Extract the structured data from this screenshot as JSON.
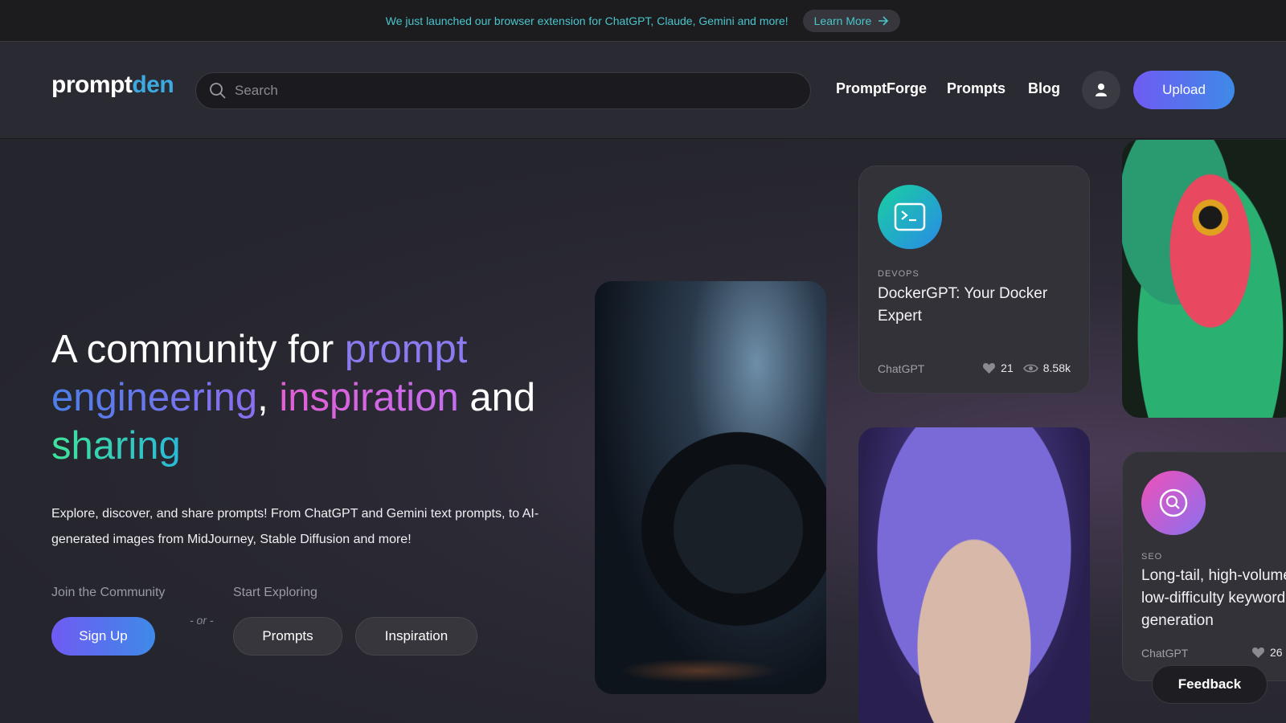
{
  "announcement": {
    "text": "We just launched our browser extension for ChatGPT, Claude, Gemini and more!",
    "button": "Learn More",
    "icon": "arrow-right-icon"
  },
  "header": {
    "logo_a": "prompt",
    "logo_b": "den",
    "search_placeholder": "Search",
    "nav": [
      "PromptForge",
      "Prompts",
      "Blog"
    ],
    "upload": "Upload"
  },
  "hero": {
    "headline": {
      "p1": "A community for ",
      "prompt": "prompt",
      "engineering": "engineering",
      "comma": ", ",
      "inspiration": "inspiration",
      "and": " and",
      "sharing": "sharing"
    },
    "description": "Explore, discover, and share prompts! From ChatGPT and Gemini text prompts, to AI-generated images from MidJourney, Stable Diffusion and more!",
    "join_label": "Join the Community",
    "explore_label": "Start Exploring",
    "signup": "Sign Up",
    "or": "- or -",
    "prompts_btn": "Prompts",
    "inspiration_btn": "Inspiration"
  },
  "cards": [
    {
      "category": "DEVOPS",
      "title": "DockerGPT: Your Docker Expert",
      "model": "ChatGPT",
      "likes": "21",
      "views": "8.58k",
      "icon": "terminal-icon"
    },
    {
      "category": "SEO",
      "title": "Long-tail, high-volume, low-difficulty keyword generation",
      "model": "ChatGPT",
      "likes": "26",
      "icon": "search-magnifier-icon"
    }
  ],
  "feedback": "Feedback",
  "colors": {
    "accent_teal": "#49c5cc",
    "logo_blue": "#3ea8e0",
    "button_gradient_start": "#6f5bf3",
    "button_gradient_end": "#3e8ae8"
  }
}
